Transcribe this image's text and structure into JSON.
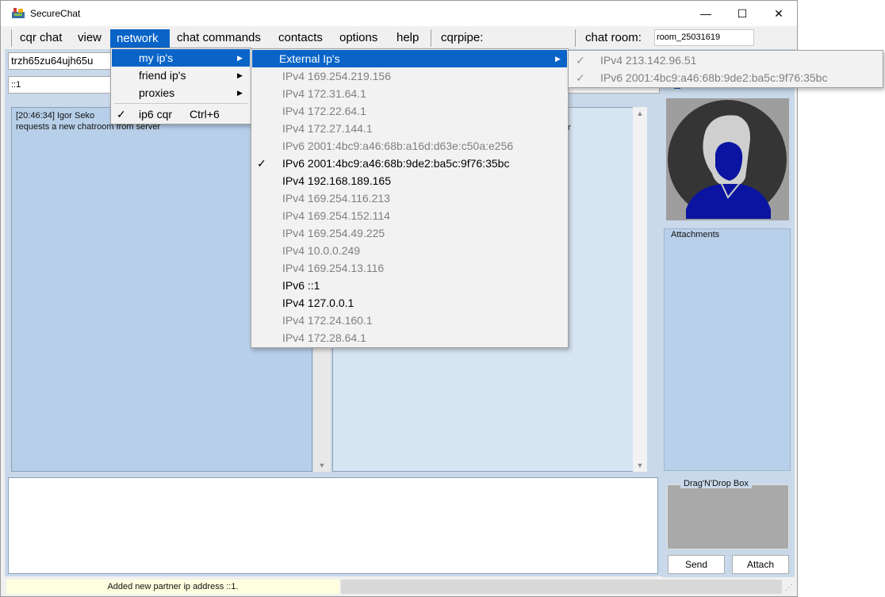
{
  "window": {
    "title": "SecureChat",
    "controls": [
      "—",
      "☐",
      "✕"
    ]
  },
  "menubar": {
    "items": [
      "cqr chat",
      "view",
      "network",
      "chat commands",
      "contacts",
      "options",
      "help",
      "cqrpipe:"
    ],
    "active": "network",
    "chat_room_label": "chat room:",
    "chat_room_value": "room_25031619"
  },
  "inputs": {
    "nick": "trzh65zu64ujh65u",
    "ip": "::1"
  },
  "chat": {
    "left_message": "[20:46:34] Igor Seko\nrequests a new chatroom from server",
    "right_fragment": "r"
  },
  "panels": {
    "attachments_label": "Attachments",
    "dnd_label": "Drag'N'Drop Box"
  },
  "buttons": {
    "send": "Send",
    "attach": "Attach"
  },
  "status": {
    "message": "Added new partner ip address ::1."
  },
  "network_menu": {
    "items": [
      {
        "label": "my ip's",
        "submenu": true,
        "highlighted": true
      },
      {
        "label": "friend ip's",
        "submenu": true
      },
      {
        "label": "proxies",
        "submenu": true
      },
      {
        "label": "ip6 cqr",
        "checked": true,
        "shortcut": "Ctrl+6"
      }
    ]
  },
  "my_ips_menu": {
    "header": "External Ip's",
    "items": [
      {
        "label": "IPv4 169.254.219.156",
        "enabled": false
      },
      {
        "label": "IPv4 172.31.64.1",
        "enabled": false
      },
      {
        "label": "IPv4 172.22.64.1",
        "enabled": false
      },
      {
        "label": "IPv4 172.27.144.1",
        "enabled": false
      },
      {
        "label": "IPv6 2001:4bc9:a46:68b:a16d:d63e:c50a:e256",
        "enabled": false
      },
      {
        "label": "IPv6 2001:4bc9:a46:68b:9de2:ba5c:9f76:35bc",
        "enabled": true,
        "checked": true
      },
      {
        "label": "IPv4 192.168.189.165",
        "enabled": true
      },
      {
        "label": "IPv4 169.254.116.213",
        "enabled": false
      },
      {
        "label": "IPv4 169.254.152.114",
        "enabled": false
      },
      {
        "label": "IPv4 169.254.49.225",
        "enabled": false
      },
      {
        "label": "IPv4 10.0.0.249",
        "enabled": false
      },
      {
        "label": "IPv4 169.254.13.116",
        "enabled": false
      },
      {
        "label": "IPv6 ::1",
        "enabled": true
      },
      {
        "label": "IPv4 127.0.0.1",
        "enabled": true
      },
      {
        "label": "IPv4 172.24.160.1",
        "enabled": false
      },
      {
        "label": "IPv4 172.28.64.1",
        "enabled": false
      }
    ]
  },
  "external_menu": {
    "items": [
      {
        "label": "IPv4 213.142.96.51",
        "checked": true
      },
      {
        "label": "IPv6 2001:4bc9:a46:68b:9de2:ba5c:9f76:35bc",
        "checked": true
      }
    ]
  },
  "colors": {
    "accent": "#0a64c8",
    "panel": "#c9d9ea",
    "chat_left": "#b8cfe9",
    "avatar_fill": "#0a14a0"
  }
}
